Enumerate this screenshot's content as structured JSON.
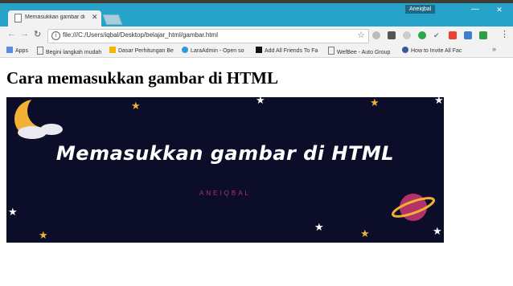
{
  "browser": {
    "user_badge": "Aneiqbal",
    "tab_title": "Memasukkan gambar di",
    "url": "file:///C:/Users/iqbal/Desktop/belajar_html/gambar.html",
    "minimize_label": "—",
    "maximize_label": "☐",
    "close_label": "✕"
  },
  "bookmarks": [
    {
      "label": "Apps"
    },
    {
      "label": "Begini langkah mudah"
    },
    {
      "label": "Dasar Perhitungan Be"
    },
    {
      "label": "LaraAdmin - Open so"
    },
    {
      "label": "Add All Friends To Fa"
    },
    {
      "label": "WefBee - Auto Group"
    },
    {
      "label": "How to Invite All Fac"
    }
  ],
  "page": {
    "heading": "Cara memasukkan gambar di HTML",
    "banner_title": "Memasukkan gambar di HTML",
    "banner_subtitle": "ANEIQBAL"
  },
  "colors": {
    "titlebar": "#27a3c9",
    "banner_bg": "#0b0d29",
    "accent_pink": "#b3326a",
    "star_gold": "#f2b134"
  }
}
